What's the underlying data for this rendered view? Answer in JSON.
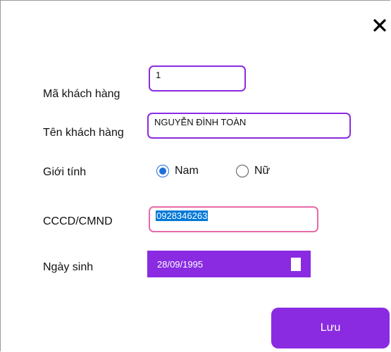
{
  "form": {
    "ma_kh": {
      "label": "Mã khách hàng",
      "value": "1"
    },
    "ten_kh": {
      "label": "Tên khách hàng",
      "value": "NGUYỄN ĐÌNH TOÀN"
    },
    "gioi_tinh": {
      "label": "Giới tính",
      "options": [
        {
          "label": "Nam",
          "checked": true
        },
        {
          "label": "Nữ",
          "checked": false
        }
      ]
    },
    "cccd": {
      "label": "CCCD/CMND",
      "value": "0928346263"
    },
    "ngay_sinh": {
      "label": "Ngày sinh",
      "value": "28/09/1995"
    }
  },
  "buttons": {
    "save": "Lưu",
    "close_icon": "close-icon"
  },
  "colors": {
    "accent": "#8a2be2",
    "pink_border": "#e86aa8",
    "radio_selected": "#1e6fd9",
    "selection": "#0078d7"
  }
}
